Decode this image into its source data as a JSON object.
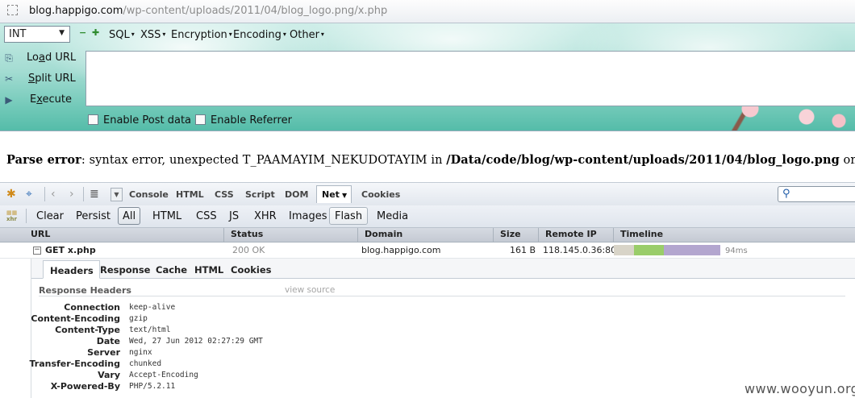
{
  "address_bar": {
    "host": "blog.happigo.com",
    "path": "/wp-content/uploads/2011/04/blog_logo.png/x.php"
  },
  "hackbar": {
    "int_select": "INT",
    "menus": [
      "SQL",
      "XSS",
      "Encryption",
      "Encoding",
      "Other"
    ],
    "load_url": {
      "prefix": "Lo",
      "accel": "a",
      "suffix": "d URL"
    },
    "split_url": {
      "prefix": "",
      "accel": "S",
      "suffix": "plit URL"
    },
    "execute": {
      "prefix": "E",
      "accel": "x",
      "suffix": "ecute"
    },
    "enable_post": "Enable Post data",
    "enable_referrer": "Enable Referrer",
    "url_value": ""
  },
  "parse_error": {
    "label": "Parse error",
    "message": ": syntax error, unexpected T_PAAMAYIM_NEKUDOTAYIM in ",
    "file": "/Data/code/blog/wp-content/uploads/2011/04/blog_logo.png",
    "tail": " on"
  },
  "firebug": {
    "tabs": [
      "Console",
      "HTML",
      "CSS",
      "Script",
      "DOM",
      "Net",
      "Cookies"
    ],
    "active_tab": "Net",
    "filters": [
      "Clear",
      "Persist",
      "All",
      "HTML",
      "CSS",
      "JS",
      "XHR",
      "Images",
      "Flash",
      "Media"
    ],
    "xhr_icon_text": "xhr",
    "columns": [
      "URL",
      "Status",
      "Domain",
      "Size",
      "Remote IP",
      "Timeline"
    ],
    "request": {
      "url": "GET x.php",
      "status": "200 OK",
      "domain": "blog.happigo.com",
      "size": "161 B",
      "remote_ip": "118.145.0.36:80",
      "time": "94ms"
    },
    "detail_tabs": [
      "Headers",
      "Response",
      "Cache",
      "HTML",
      "Cookies"
    ],
    "response_headers_title": "Response Headers",
    "view_source": "view source",
    "headers": [
      {
        "name": "Connection",
        "value": "keep-alive"
      },
      {
        "name": "Content-Encoding",
        "value": "gzip"
      },
      {
        "name": "Content-Type",
        "value": "text/html"
      },
      {
        "name": "Date",
        "value": "Wed, 27 Jun 2012 02:27:29 GMT"
      },
      {
        "name": "Server",
        "value": "nginx"
      },
      {
        "name": "Transfer-Encoding",
        "value": "chunked"
      },
      {
        "name": "Vary",
        "value": "Accept-Encoding"
      },
      {
        "name": "X-Powered-By",
        "value": "PHP/5.2.11"
      }
    ]
  },
  "watermark": "www.wooyun.org",
  "colors": {
    "timeline_blocking": "#d8d4c8",
    "timeline_waiting": "#9acd6a",
    "timeline_receiving": "#b3a6cf"
  }
}
